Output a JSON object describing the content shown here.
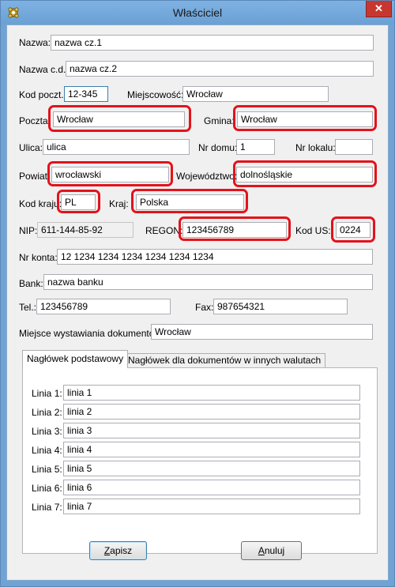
{
  "window": {
    "title": "Właściciel",
    "close_glyph": "✕",
    "accent": "#e3131b"
  },
  "form": {
    "nazwa": {
      "label": "Nazwa:",
      "value": "nazwa cz.1"
    },
    "nazwa_cd": {
      "label": "Nazwa c.d.:",
      "value": "nazwa cz.2"
    },
    "kod_pocztowy": {
      "label": "Kod poczt.:",
      "value": "12-345"
    },
    "miejscowosc": {
      "label": "Miejscowość:",
      "value": "Wrocław"
    },
    "poczta": {
      "label": "Poczta:",
      "value": "Wrocław"
    },
    "gmina": {
      "label": "Gmina:",
      "value": "Wrocław"
    },
    "ulica": {
      "label": "Ulica:",
      "value": "ulica"
    },
    "nr_domu": {
      "label": "Nr domu:",
      "value": "1"
    },
    "nr_lokalu": {
      "label": "Nr lokalu:",
      "value": ""
    },
    "powiat": {
      "label": "Powiat:",
      "value": "wrocławski"
    },
    "wojewodztwo": {
      "label": "Województwo:",
      "value": "dolnośląskie"
    },
    "kod_kraju": {
      "label": "Kod kraju:",
      "value": "PL"
    },
    "kraj": {
      "label": "Kraj:",
      "value": "Polska"
    },
    "nip": {
      "label": "NIP:",
      "value": "611-144-85-92"
    },
    "regon": {
      "label": "REGON:",
      "value": "123456789"
    },
    "kod_us": {
      "label": "Kod US:",
      "value": "0224"
    },
    "nr_konta": {
      "label": "Nr konta:",
      "value": "12 1234 1234 1234 1234 1234 1234"
    },
    "bank": {
      "label": "Bank:",
      "value": "nazwa banku"
    },
    "tel": {
      "label": "Tel.:",
      "value": "123456789"
    },
    "fax": {
      "label": "Fax:",
      "value": "987654321"
    },
    "miejsce": {
      "label": "Miejsce wystawiania dokumentów:",
      "value": "Wrocław"
    }
  },
  "tabs": [
    {
      "label": "Nagłówek podstawowy",
      "active": true
    },
    {
      "label": "Nagłówek dla dokumentów w innych walutach",
      "active": false
    }
  ],
  "header_lines": [
    {
      "label": "Linia 1:",
      "value": "linia 1"
    },
    {
      "label": "Linia 2:",
      "value": "linia 2"
    },
    {
      "label": "Linia 3:",
      "value": "linia 3"
    },
    {
      "label": "Linia 4:",
      "value": "linia 4"
    },
    {
      "label": "Linia 5:",
      "value": "linia 5"
    },
    {
      "label": "Linia 6:",
      "value": "linia 6"
    },
    {
      "label": "Linia 7:",
      "value": "linia 7"
    }
  ],
  "buttons": {
    "save": {
      "accel": "Z",
      "rest": "apisz"
    },
    "cancel": {
      "accel": "A",
      "rest": "nuluj"
    }
  }
}
